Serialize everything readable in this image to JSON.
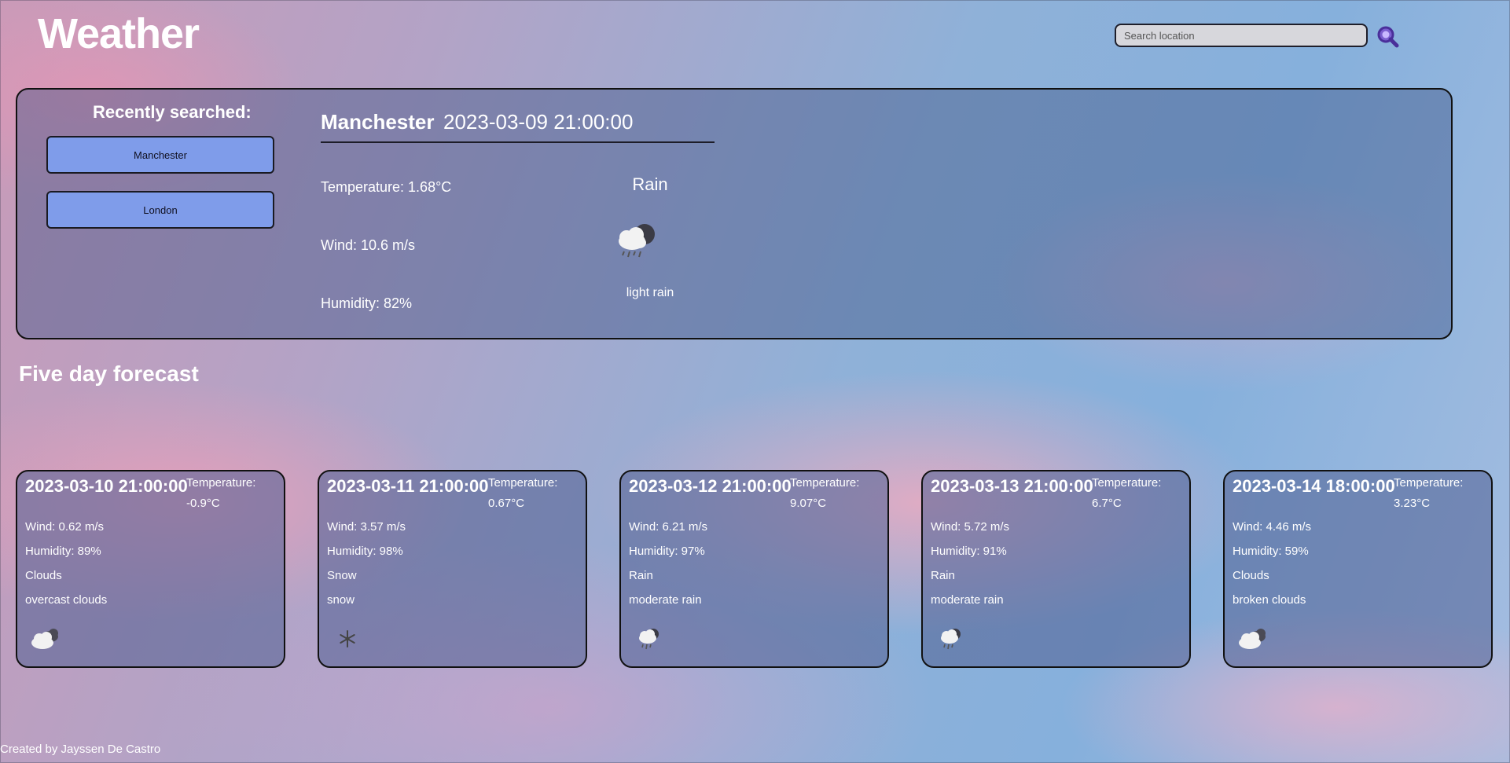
{
  "header": {
    "title": "Weather",
    "search_placeholder": "Search location",
    "search_icon": "search-magnifier-icon"
  },
  "recent": {
    "title": "Recently searched:",
    "items": [
      "Manchester",
      "London"
    ]
  },
  "current": {
    "city": "Manchester",
    "datetime": "2023-03-09 21:00:00",
    "temperature": "Temperature: 1.68°C",
    "wind": "Wind: 10.6 m/s",
    "humidity": "Humidity: 82%",
    "main": "Rain",
    "description": "light rain",
    "icon": "night-rain-cloud-icon"
  },
  "forecast": {
    "title": "Five day forecast",
    "days": [
      {
        "date": "2023-03-10 21:00:00",
        "temp_label": "Temperature:",
        "temp_value": "-0.9°C",
        "wind": "Wind: 0.62 m/s",
        "humidity": "Humidity: 89%",
        "main": "Clouds",
        "description": "overcast clouds",
        "icon": "cloudy-icon"
      },
      {
        "date": "2023-03-11 21:00:00",
        "temp_label": "Temperature:",
        "temp_value": "0.67°C",
        "wind": "Wind: 3.57 m/s",
        "humidity": "Humidity: 98%",
        "main": "Snow",
        "description": "snow",
        "icon": "snowflake-icon"
      },
      {
        "date": "2023-03-12 21:00:00",
        "temp_label": "Temperature:",
        "temp_value": "9.07°C",
        "wind": "Wind: 6.21 m/s",
        "humidity": "Humidity: 97%",
        "main": "Rain",
        "description": "moderate rain",
        "icon": "rain-cloud-icon"
      },
      {
        "date": "2023-03-13 21:00:00",
        "temp_label": "Temperature:",
        "temp_value": "6.7°C",
        "wind": "Wind: 5.72 m/s",
        "humidity": "Humidity: 91%",
        "main": "Rain",
        "description": "moderate rain",
        "icon": "rain-cloud-icon"
      },
      {
        "date": "2023-03-14 18:00:00",
        "temp_label": "Temperature:",
        "temp_value": "3.23°C",
        "wind": "Wind: 4.46 m/s",
        "humidity": "Humidity: 59%",
        "main": "Clouds",
        "description": "broken clouds",
        "icon": "broken-clouds-icon"
      }
    ]
  },
  "footer": {
    "credit": "Created by Jayssen De Castro"
  },
  "colors": {
    "recent_button_bg": "#7f9cea",
    "panel_border": "#111111",
    "search_icon": "#6a4fc4"
  }
}
